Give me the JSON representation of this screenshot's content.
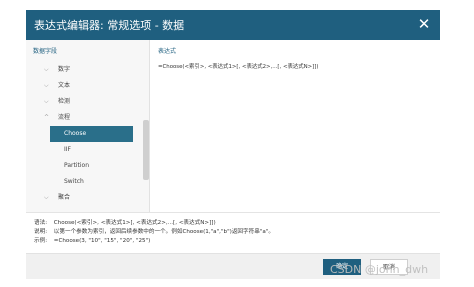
{
  "dialog": {
    "title": "表达式编辑器: 常规选项 - 数据",
    "close_icon": "close-icon"
  },
  "left_panel": {
    "header": "数据字段",
    "tree": [
      {
        "label": "数字",
        "type": "group"
      },
      {
        "label": "文本",
        "type": "group"
      },
      {
        "label": "检测",
        "type": "group"
      },
      {
        "label": "流程",
        "type": "group-open"
      },
      {
        "label": "Choose",
        "type": "selected"
      },
      {
        "label": "IIF",
        "type": "child"
      },
      {
        "label": "Partition",
        "type": "child"
      },
      {
        "label": "Switch",
        "type": "child"
      },
      {
        "label": "聚合",
        "type": "group"
      }
    ]
  },
  "right_panel": {
    "header": "表达式",
    "expression": "=Choose(<索引>, <表达式1>[, <表达式2>,...[, <表达式N>]])"
  },
  "help": {
    "syntax_key": "语法:",
    "syntax_val": "Choose(<索引>, <表达式1>[, <表达式2>,...[, <表达式N>]])",
    "desc_key": "说明:",
    "desc_val": "以第一个参数为索引，返回后续参数中的一个。例如Choose(1,\"a\",\"b\")返回字符串\"a\"。",
    "example_key": "示例:",
    "example_val": "=Choose(3, \"10\", \"15\", \"20\", \"25\")"
  },
  "footer": {
    "ok_label": "确定",
    "cancel_label": "取消"
  },
  "watermark": "CSDN @john_dwh",
  "colors": {
    "title_bar": "#1f5f7f",
    "selected": "#2a6f8a",
    "accent_text": "#1f5f7f"
  }
}
